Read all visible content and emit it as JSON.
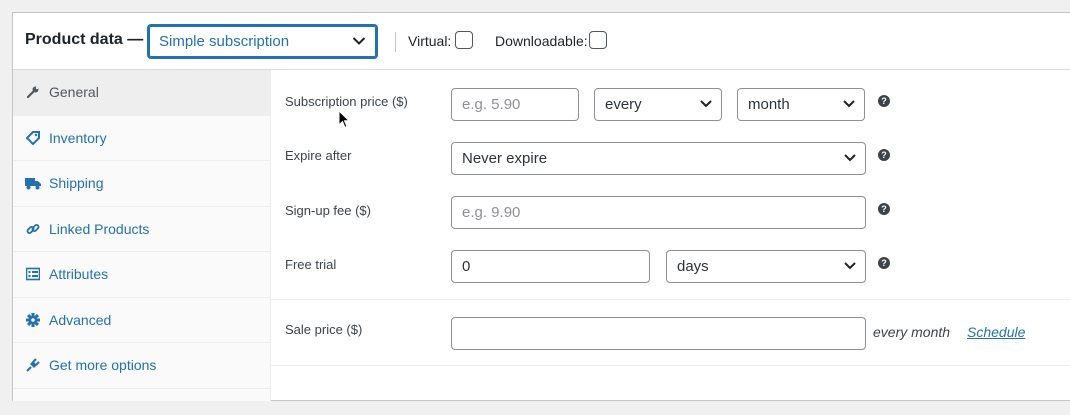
{
  "header": {
    "title": "Product data —",
    "product_type": "Simple subscription",
    "virtual_label": "Virtual:",
    "downloadable_label": "Downloadable:"
  },
  "sidebar": {
    "tabs": [
      {
        "label": "General",
        "icon": "wrench-icon",
        "active": true
      },
      {
        "label": "Inventory",
        "icon": "tag-icon",
        "active": false
      },
      {
        "label": "Shipping",
        "icon": "truck-icon",
        "active": false
      },
      {
        "label": "Linked Products",
        "icon": "link-icon",
        "active": false
      },
      {
        "label": "Attributes",
        "icon": "list-icon",
        "active": false
      },
      {
        "label": "Advanced",
        "icon": "gear-icon",
        "active": false
      },
      {
        "label": "Get more options",
        "icon": "plug-icon",
        "active": false
      }
    ]
  },
  "form": {
    "subscription_price": {
      "label": "Subscription price ($)",
      "placeholder": "e.g. 5.90",
      "interval": "every",
      "period": "month"
    },
    "expire_after": {
      "label": "Expire after",
      "value": "Never expire"
    },
    "signup_fee": {
      "label": "Sign-up fee ($)",
      "placeholder": "e.g. 9.90"
    },
    "free_trial": {
      "label": "Free trial",
      "value": "0",
      "unit": "days"
    },
    "sale_price": {
      "label": "Sale price ($)",
      "value": "",
      "suffix": "every month",
      "schedule_link": "Schedule"
    },
    "help_glyph": "?"
  },
  "colors": {
    "accent": "#2271b1",
    "text": "#3c434a",
    "border": "#8c8f94"
  }
}
